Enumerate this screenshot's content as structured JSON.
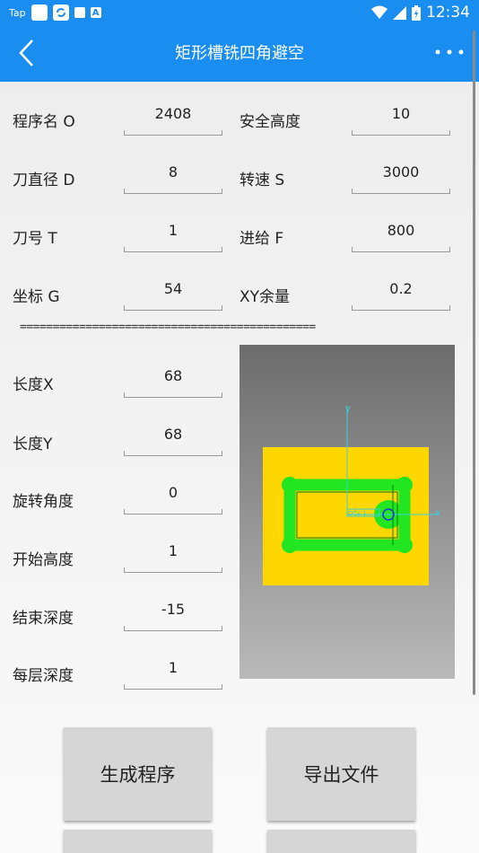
{
  "status": {
    "left_app_label": "Tap",
    "time": "12:34",
    "icons": [
      "tap-app-icon",
      "square-icon",
      "sync-icon",
      "mail-icon",
      "a-icon",
      "wifi-icon",
      "signal-icon",
      "battery-icon"
    ]
  },
  "appbar": {
    "title": "矩形槽铣四角避空",
    "back_icon": "chevron-left-icon",
    "more_icon": "more-dots-icon"
  },
  "params": {
    "program_label": "程序名 O",
    "program_value": "2408",
    "safe_height_label": "安全高度",
    "safe_height_value": "10",
    "tool_dia_label": "刀直径 D",
    "tool_dia_value": "8",
    "speed_label": "转速 S",
    "speed_value": "3000",
    "tool_no_label": "刀号 T",
    "tool_no_value": "1",
    "feed_label": "进给 F",
    "feed_value": "800",
    "coord_label": "坐标 G",
    "coord_value": "54",
    "xy_allow_label": "XY余量",
    "xy_allow_value": "0.2"
  },
  "divider_text": "=============================================",
  "geometry": {
    "length_x_label": "长度X",
    "length_x_value": "68",
    "length_y_label": "长度Y",
    "length_y_value": "68",
    "rotation_label": "旋转角度",
    "rotation_value": "0",
    "start_height_label": "开始高度",
    "start_height_value": "1",
    "end_depth_label": "结束深度",
    "end_depth_value": "-15",
    "layer_depth_label": "每层深度",
    "layer_depth_value": "1"
  },
  "preview": {
    "axis_x_label": "x",
    "axis_y_label": "y",
    "origin_label": "DCs 1",
    "colors": {
      "stock": "#ffd700",
      "toolpath": "#22e622",
      "axis": "#3ad0d8",
      "tool": "#1c3bd6"
    }
  },
  "buttons": {
    "generate": "生成程序",
    "export": "导出文件"
  }
}
